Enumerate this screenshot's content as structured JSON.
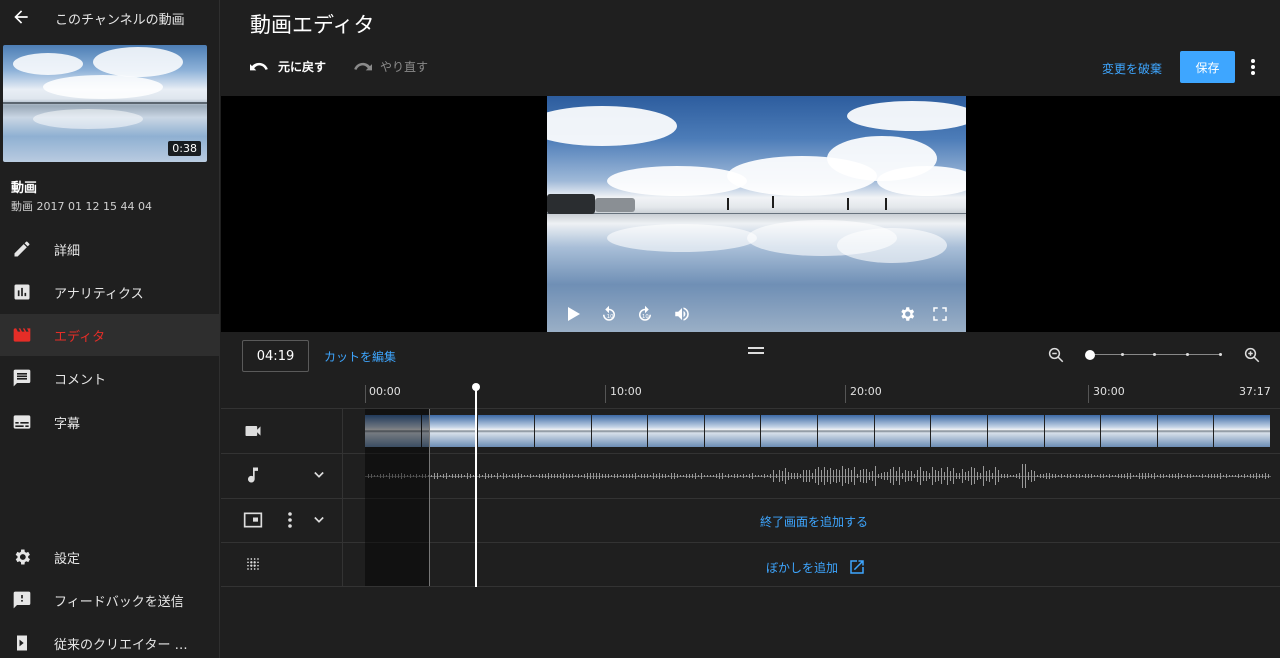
{
  "sidebar": {
    "back_label": "このチャンネルの動画",
    "thumbnail_duration": "0:38",
    "video_title": "動画",
    "video_subtitle": "動画 2017 01 12 15 44 04",
    "items": [
      {
        "label": "詳細",
        "icon": "pencil-icon"
      },
      {
        "label": "アナリティクス",
        "icon": "analytics-icon"
      },
      {
        "label": "エディタ",
        "icon": "editor-clapper-icon",
        "active": true
      },
      {
        "label": "コメント",
        "icon": "comment-icon"
      },
      {
        "label": "字幕",
        "icon": "subtitles-icon"
      }
    ],
    "bottom_items": [
      {
        "label": "設定",
        "icon": "gear-icon"
      },
      {
        "label": "フィードバックを送信",
        "icon": "feedback-icon"
      },
      {
        "label": "従来のクリエイター …",
        "icon": "classic-studio-icon"
      }
    ],
    "active_color": "#e52d27"
  },
  "header": {
    "title": "動画エディタ",
    "undo_label": "元に戻す",
    "redo_label": "やり直す",
    "discard_label": "変更を破棄",
    "save_label": "保存"
  },
  "timeline": {
    "current_time": "04:19",
    "edit_cut_label": "カットを編集",
    "ruler": [
      "00:00",
      "10:00",
      "20:00",
      "30:00",
      "37:17"
    ],
    "end_screen_label": "終了画面を追加する",
    "blur_label": "ぼかしを追加"
  },
  "colors": {
    "accent": "#3ea6ff",
    "background": "#1f1f1f"
  }
}
